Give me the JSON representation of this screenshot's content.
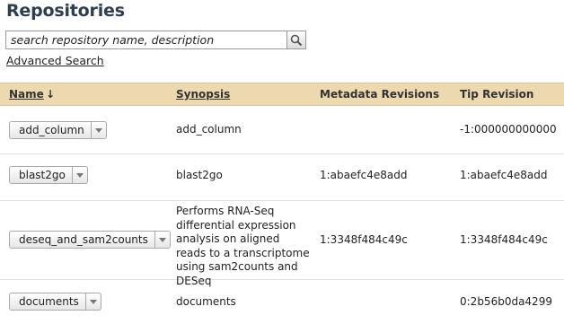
{
  "page": {
    "title": "Repositories"
  },
  "search": {
    "placeholder": "search repository name, description",
    "value": "search repository name, description",
    "advanced_link": "Advanced Search"
  },
  "table": {
    "headers": {
      "name": "Name",
      "sort_indicator": "↓",
      "synopsis": "Synopsis",
      "metadata_revisions": "Metadata Revisions",
      "tip_revision": "Tip Revision"
    },
    "rows": [
      {
        "name": "add_column",
        "synopsis": "add_column",
        "metadata_revisions": "",
        "tip_revision": "-1:000000000000"
      },
      {
        "name": "blast2go",
        "synopsis": "blast2go",
        "metadata_revisions": "1:abaefc4e8add",
        "tip_revision": "1:abaefc4e8add"
      },
      {
        "name": "deseq_and_sam2counts",
        "synopsis": "Performs RNA-Seq differential expression analysis on aligned reads to a transcriptome using sam2counts and DESeq",
        "metadata_revisions": "1:3348f484c49c",
        "tip_revision": "1:3348f484c49c"
      },
      {
        "name": "documents",
        "synopsis": "documents",
        "metadata_revisions": "",
        "tip_revision": "0:2b56b0da4299"
      }
    ]
  },
  "colors": {
    "title": "#2c3e50",
    "header_bg": "#ecd9b0"
  },
  "icons": {
    "search": "magnifier-icon",
    "dropdown": "chevron-down-icon"
  }
}
